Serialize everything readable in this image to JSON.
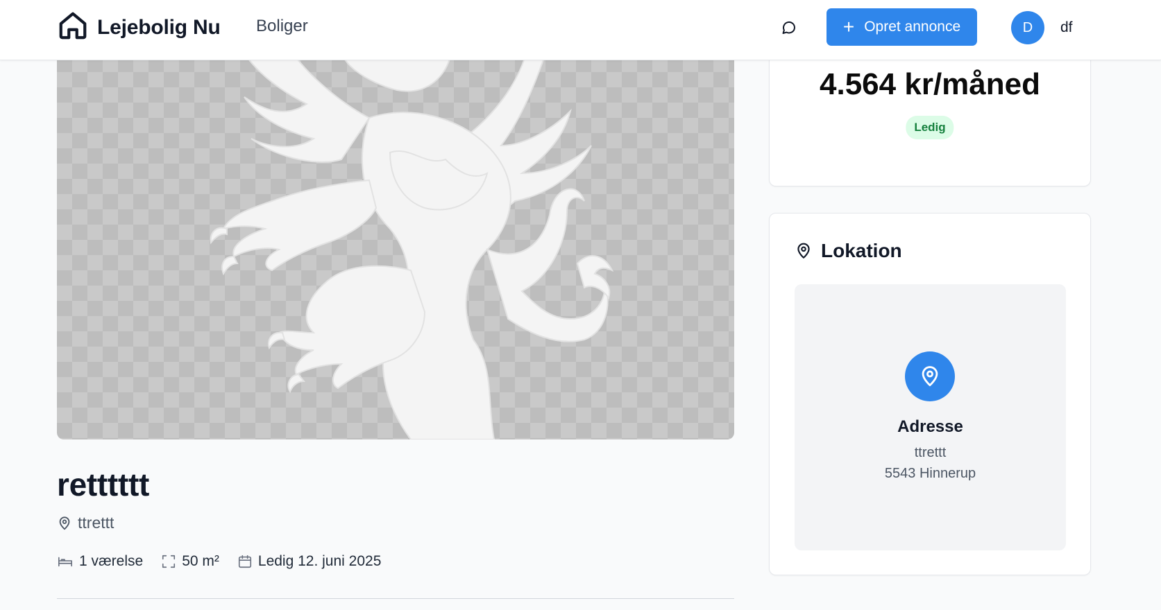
{
  "header": {
    "brand_name": "Lejebolig Nu",
    "nav_link": "Boliger",
    "create_button_label": "Opret annonce",
    "user_initial": "D",
    "username": "df"
  },
  "listing": {
    "title": "retttttt",
    "address_short": "ttrettt",
    "rooms": "1 værelse",
    "area": "50 m²",
    "available": "Ledig 12. juni 2025"
  },
  "price_card": {
    "price": "4.564 kr/måned",
    "status_badge": "Ledig"
  },
  "location_card": {
    "heading": "Lokation",
    "address_label": "Adresse",
    "street": "ttrettt",
    "city": "5543 Hinnerup"
  },
  "colors": {
    "accent": "#2f86eb",
    "badge_bg": "#dcfce7",
    "badge_text": "#15803d"
  },
  "icons": [
    "home-icon",
    "chat-icon",
    "plus-icon",
    "map-pin-icon",
    "bed-icon",
    "expand-icon",
    "calendar-icon"
  ]
}
